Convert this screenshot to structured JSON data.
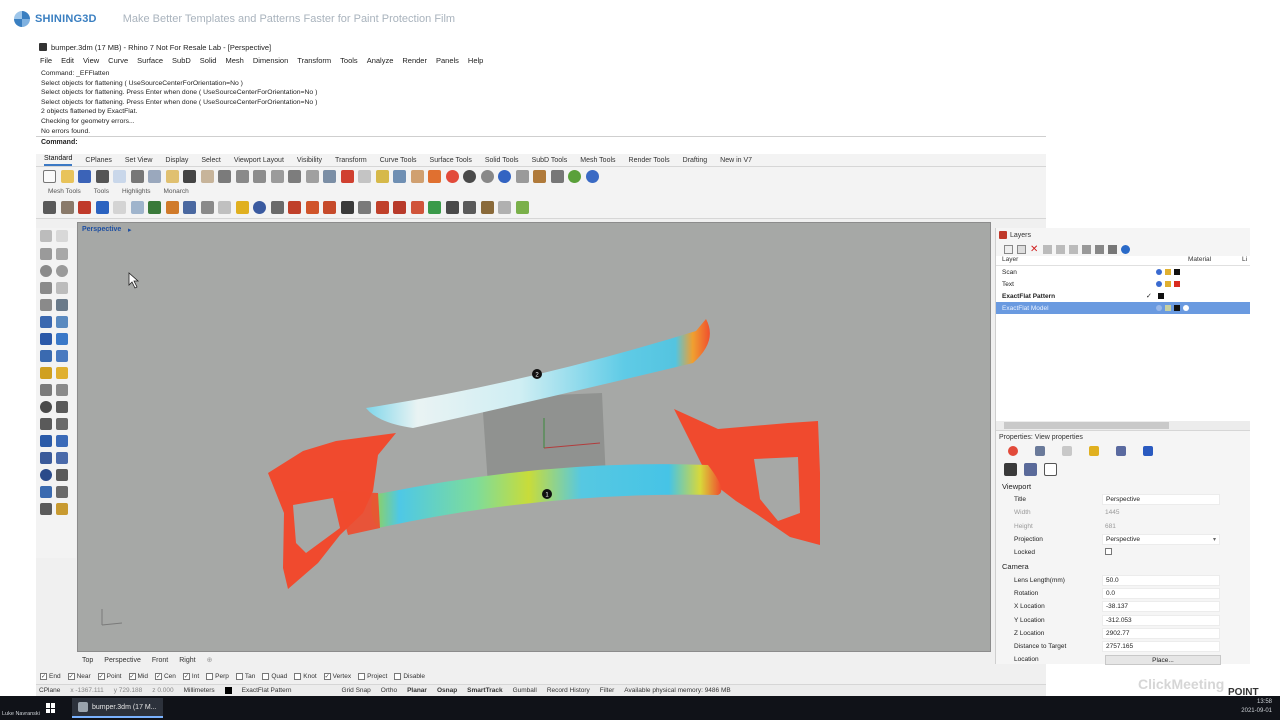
{
  "banner": {
    "brand": "SHINING3D",
    "title": "Make Better Templates and Patterns Faster for Paint Protection Film"
  },
  "window": {
    "title": "bumper.3dm (17 MB) - Rhino 7 Not For Resale Lab - [Perspective]"
  },
  "menu": [
    "File",
    "Edit",
    "View",
    "Curve",
    "Surface",
    "SubD",
    "Solid",
    "Mesh",
    "Dimension",
    "Transform",
    "Tools",
    "Analyze",
    "Render",
    "Panels",
    "Help"
  ],
  "command_history": [
    "Command: _EFFlatten",
    "Select objects for flattening ( UseSourceCenterForOrientation=No )",
    "Select objects for flattening. Press Enter when done ( UseSourceCenterForOrientation=No )",
    "Select objects for flattening. Press Enter when done ( UseSourceCenterForOrientation=No )",
    "2 objects flattened by ExactFlat.",
    "Checking for geometry errors...",
    "No errors found."
  ],
  "command_prompt": "Command:",
  "toolbar_tabs": [
    "Standard",
    "CPlanes",
    "Set View",
    "Display",
    "Select",
    "Viewport Layout",
    "Visibility",
    "Transform",
    "Curve Tools",
    "Surface Tools",
    "Solid Tools",
    "SubD Tools",
    "Mesh Tools",
    "Render Tools",
    "Drafting",
    "New in V7"
  ],
  "sub_tabs": [
    "Mesh Tools",
    "Tools",
    "Highlights",
    "Monarch"
  ],
  "viewport": {
    "label": "Perspective",
    "markers": [
      "2",
      "1"
    ]
  },
  "viewport_tabs": [
    "Top",
    "Perspective",
    "Front",
    "Right"
  ],
  "osnaps": [
    {
      "label": "End",
      "checked": true
    },
    {
      "label": "Near",
      "checked": true
    },
    {
      "label": "Point",
      "checked": true
    },
    {
      "label": "Mid",
      "checked": true
    },
    {
      "label": "Cen",
      "checked": true
    },
    {
      "label": "Int",
      "checked": true
    },
    {
      "label": "Perp",
      "checked": false
    },
    {
      "label": "Tan",
      "checked": false
    },
    {
      "label": "Quad",
      "checked": false
    },
    {
      "label": "Knot",
      "checked": false
    },
    {
      "label": "Vertex",
      "checked": true
    },
    {
      "label": "Project",
      "checked": false
    },
    {
      "label": "Disable",
      "checked": false
    }
  ],
  "status": {
    "cplane": "CPlane",
    "x": "x -1367.111",
    "y": "y 729.188",
    "z": "z 0.000",
    "units": "Millimeters",
    "layer": "ExactFlat Pattern",
    "grid_snap": "Grid Snap",
    "ortho": "Ortho",
    "planar": "Planar",
    "osnap": "Osnap",
    "smarttrack": "SmartTrack",
    "gumball": "Gumball",
    "record_history": "Record History",
    "filter": "Filter",
    "memory": "Available physical memory: 9486 MB"
  },
  "layers": {
    "panel_title": "Layers",
    "columns": [
      "Layer",
      "Material",
      "Li"
    ],
    "rows": [
      {
        "name": "Scan",
        "color": "#111111",
        "bold": false,
        "selected": false,
        "check": ""
      },
      {
        "name": "Text",
        "color": "#d92b1f",
        "bold": false,
        "selected": false,
        "check": ""
      },
      {
        "name": "ExactFlat Pattern",
        "color": "#111111",
        "bold": true,
        "selected": false,
        "check": "✓"
      },
      {
        "name": "ExactFlat Model",
        "color": "#111111",
        "bold": false,
        "selected": true,
        "check": ""
      }
    ]
  },
  "properties": {
    "title": "Properties: View properties",
    "viewport_section": "Viewport",
    "camera_section": "Camera",
    "rows": [
      {
        "key": "Title",
        "value": "Perspective",
        "dim": false
      },
      {
        "key": "Width",
        "value": "1445",
        "dim": true
      },
      {
        "key": "Height",
        "value": "681",
        "dim": true
      },
      {
        "key": "Projection",
        "value": "Perspective",
        "dim": false
      },
      {
        "key": "Locked",
        "value": "",
        "dim": false
      }
    ],
    "camera_rows": [
      {
        "key": "Lens Length(mm)",
        "value": "50.0"
      },
      {
        "key": "Rotation",
        "value": "0.0"
      },
      {
        "key": "X Location",
        "value": "-38.137"
      },
      {
        "key": "Y Location",
        "value": "-312.053"
      },
      {
        "key": "Z Location",
        "value": "2902.77"
      },
      {
        "key": "Distance to Target",
        "value": "2757.165"
      },
      {
        "key": "Location",
        "value": "Place..."
      }
    ]
  },
  "watermark": {
    "cm": "ClickMeeting",
    "brand_line1": "POINT",
    "brand_line2": "3D"
  },
  "taskbar": {
    "app": "bumper.3dm (17 M...",
    "presenter": "Luke Navranski",
    "time": "13:58",
    "date": "2021-09-01"
  },
  "colors": {
    "accent": "#3c79c4",
    "viewport_bg": "#a6a8a6",
    "mesh_red": "#f04a2e",
    "mesh_cyan": "#4ec8e6",
    "layer_selected": "#6a9ae0"
  }
}
